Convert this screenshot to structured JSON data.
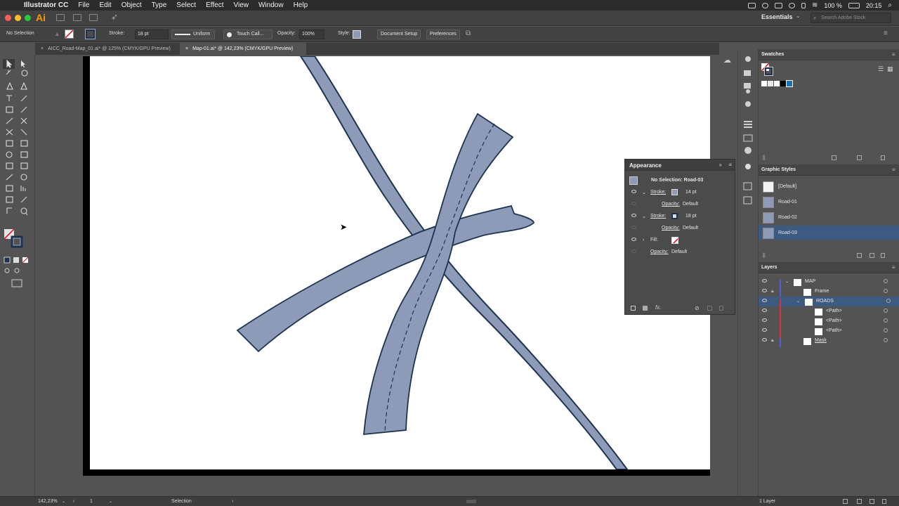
{
  "menubar": {
    "app_name": "Illustrator CC",
    "items": [
      "File",
      "Edit",
      "Object",
      "Type",
      "Select",
      "Effect",
      "View",
      "Window",
      "Help"
    ],
    "battery": "100 %",
    "time": "20:15"
  },
  "appbar": {
    "logo": "Ai",
    "workspace": "Essentials",
    "search_placeholder": "Search Adobe Stock"
  },
  "control": {
    "selection": "No Selection",
    "stroke_label": "Stroke:",
    "stroke_value": "18 pt",
    "profile": "Uniform",
    "brush": "Touch Call...",
    "opacity_label": "Opacity:",
    "opacity_value": "100%",
    "style_label": "Style:",
    "document_setup": "Document Setup",
    "preferences": "Preferences"
  },
  "tabs": [
    {
      "label": "AICC_Road-Map_01.ai* @ 125% (CMYK/GPU Preview)",
      "active": false
    },
    {
      "label": "Map-01.ai* @ 142,23% (CMYK/GPU Preview)",
      "active": true
    }
  ],
  "appearance": {
    "title": "Appearance",
    "header": "No Selection: Road-03",
    "rows": [
      {
        "label": "Stroke:",
        "value": "14 pt"
      },
      {
        "label": "Opacity:",
        "value": "Default"
      },
      {
        "label": "Stroke:",
        "value": "18 pt"
      },
      {
        "label": "Opacity:",
        "value": "Default"
      },
      {
        "label": "Fill:",
        "value": ""
      },
      {
        "label": "Opacity:",
        "value": "Default"
      }
    ]
  },
  "swatches": {
    "title": "Swatches"
  },
  "graphic_styles": {
    "title": "Graphic Styles",
    "items": [
      "[Default]",
      "Road-01",
      "Road-02",
      "Road-03"
    ]
  },
  "layers": {
    "title": "Layers",
    "items": [
      {
        "label": "MAP"
      },
      {
        "label": "Frame"
      },
      {
        "label": "ROADS"
      },
      {
        "label": "<Path>"
      },
      {
        "label": "<Path>"
      },
      {
        "label": "<Path>"
      },
      {
        "label": "Mask"
      }
    ],
    "count": "1 Layer"
  },
  "status": {
    "zoom": "142,23%",
    "artboard": "1",
    "tool": "Selection"
  },
  "colors": {
    "road_fill": "#8d9bb9",
    "road_stroke": "#1c3350",
    "selected_layer": "#3d5a80",
    "accent": "#ff9a00"
  }
}
